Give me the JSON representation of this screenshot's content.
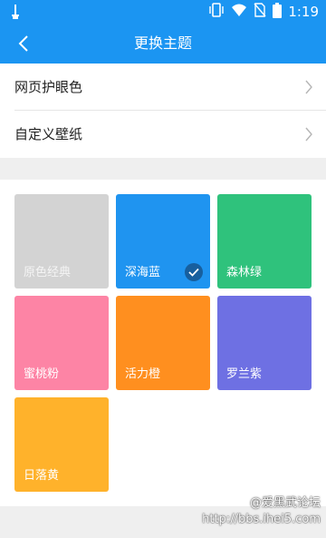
{
  "status_bar": {
    "time": "1:19",
    "icons": [
      "usb-icon",
      "vibrate-icon",
      "wifi-icon",
      "no-sim-icon",
      "battery-icon"
    ]
  },
  "app_bar": {
    "title": "更换主题",
    "back_icon": "back-arrow-icon"
  },
  "menu": {
    "items": [
      {
        "label": "网页护眼色"
      },
      {
        "label": "自定义壁纸"
      }
    ]
  },
  "themes": {
    "selected": "深海蓝",
    "items": [
      {
        "name": "原色经典",
        "color": "#d3d3d3"
      },
      {
        "name": "深海蓝",
        "color": "#1f94f0"
      },
      {
        "name": "森林绿",
        "color": "#2fc27c"
      },
      {
        "name": "蜜桃粉",
        "color": "#fd84a5"
      },
      {
        "name": "活力橙",
        "color": "#ff8f1f"
      },
      {
        "name": "罗兰紫",
        "color": "#6e70e3"
      },
      {
        "name": "日落黄",
        "color": "#ffb22b"
      }
    ]
  },
  "watermark": {
    "line1": "@爱黑武论坛",
    "line2": "http://bbs.ihei5.com"
  },
  "colors": {
    "primary": "#1b95f2",
    "background_gray": "#efefef"
  }
}
